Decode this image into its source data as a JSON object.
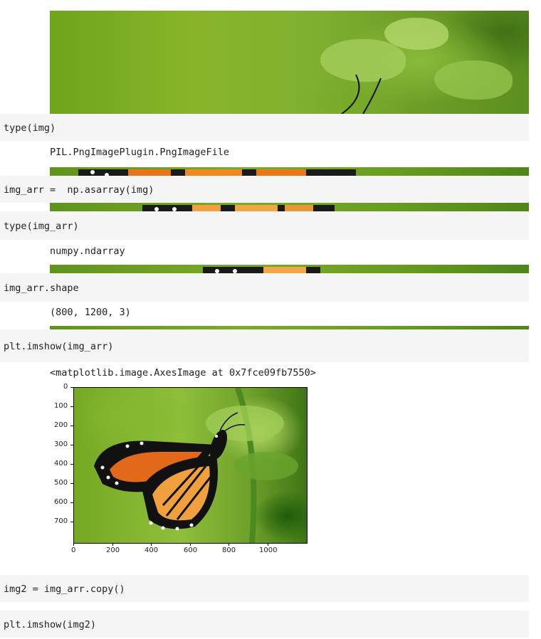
{
  "cells": {
    "c1": {
      "code": "type(img)",
      "output": "PIL.PngImagePlugin.PngImageFile"
    },
    "c2": {
      "code": "img_arr =  np.asarray(img)"
    },
    "c3": {
      "code": "type(img_arr)",
      "output": "numpy.ndarray"
    },
    "c4": {
      "code": "img_arr.shape",
      "output": "(800, 1200, 3)"
    },
    "c5": {
      "code": "plt.imshow(img_arr)",
      "output": "<matplotlib.image.AxesImage at 0x7fce09fb7550>"
    },
    "c6": {
      "code": "img2 = img_arr.copy()"
    },
    "c7": {
      "code": "plt.imshow(img2)"
    }
  },
  "plot": {
    "y_ticks": [
      "0",
      "100",
      "200",
      "300",
      "400",
      "500",
      "600",
      "700"
    ],
    "x_ticks": [
      "0",
      "200",
      "400",
      "600",
      "800",
      "1000"
    ]
  }
}
